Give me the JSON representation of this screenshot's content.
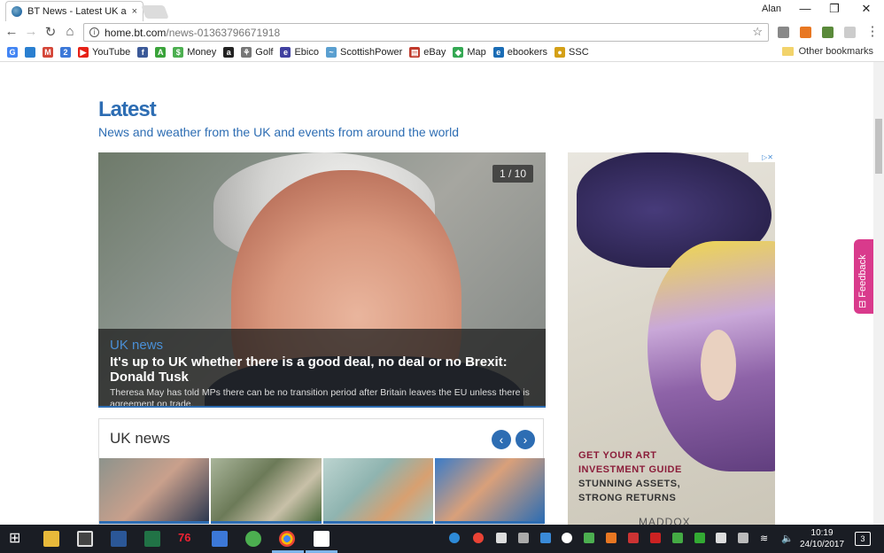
{
  "browser": {
    "tab_title": "BT News - Latest UK and",
    "tab_close": "×",
    "user": "Alan",
    "min": "—",
    "max": "❐",
    "close": "✕",
    "url_host": "home.bt.com",
    "url_path": "/news-01363796671918",
    "back": "←",
    "forward": "→",
    "reload": "↻",
    "home": "⌂",
    "star": "☆"
  },
  "bookmarks": {
    "items": [
      {
        "label": "",
        "icon": "google-icon",
        "color": "#4285f4",
        "glyph": "G"
      },
      {
        "label": "",
        "icon": "chrome-icon",
        "color": "#2a7fd0",
        "glyph": ""
      },
      {
        "label": "",
        "icon": "gmail-icon",
        "color": "#d44638",
        "glyph": "M"
      },
      {
        "label": "",
        "icon": "calendar-icon",
        "color": "#3c78d8",
        "glyph": "2"
      },
      {
        "label": "YouTube",
        "icon": "youtube-icon",
        "color": "#e62117",
        "glyph": "▶"
      },
      {
        "label": "",
        "icon": "facebook-icon",
        "color": "#3b5998",
        "glyph": "f"
      },
      {
        "label": "",
        "icon": "a-icon",
        "color": "#3aa33a",
        "glyph": "A"
      },
      {
        "label": "Money",
        "icon": "money-icon",
        "color": "#4caf50",
        "glyph": "$"
      },
      {
        "label": "",
        "icon": "amazon-icon",
        "color": "#222222",
        "glyph": "a"
      },
      {
        "label": "Golf",
        "icon": "golf-icon",
        "color": "#777777",
        "glyph": "⚘"
      },
      {
        "label": "Ebico",
        "icon": "ebico-icon",
        "color": "#4040a0",
        "glyph": "e"
      },
      {
        "label": "ScottishPower",
        "icon": "scottishpower-icon",
        "color": "#5a9fd0",
        "glyph": "~"
      },
      {
        "label": "eBay",
        "icon": "ebay-icon",
        "color": "#c0392b",
        "glyph": "▤"
      },
      {
        "label": "Map",
        "icon": "map-icon",
        "color": "#34a853",
        "glyph": "◆"
      },
      {
        "label": "ebookers",
        "icon": "ebookers-icon",
        "color": "#1a6cb5",
        "glyph": "e"
      },
      {
        "label": "SSC",
        "icon": "ssc-icon",
        "color": "#d4a017",
        "glyph": "●"
      }
    ],
    "other": "Other bookmarks"
  },
  "page": {
    "heading": "Latest",
    "subheading": "News and weather from the UK and events from around the world",
    "hero": {
      "counter": "1 / 10",
      "category": "UK news",
      "title": "It's up to UK whether there is a good deal, no deal or no Brexit: Donald Tusk",
      "text": "Theresa May has told MPs there can be no transition period after Britain leaves the EU unless there is agreement on trade."
    },
    "uknews": {
      "title": "UK news",
      "prev": "‹",
      "next": "›"
    },
    "ad": {
      "close": "▷✕",
      "line1": "GET YOUR ART",
      "line2": "INVESTMENT GUIDE",
      "line3": "STUNNING ASSETS,",
      "line4": "STRONG RETURNS",
      "brand": "MADDOX"
    },
    "feedback": "⊟ Feedback"
  },
  "taskbar": {
    "time": "10:19",
    "date": "24/10/2017",
    "notifications": "3"
  }
}
